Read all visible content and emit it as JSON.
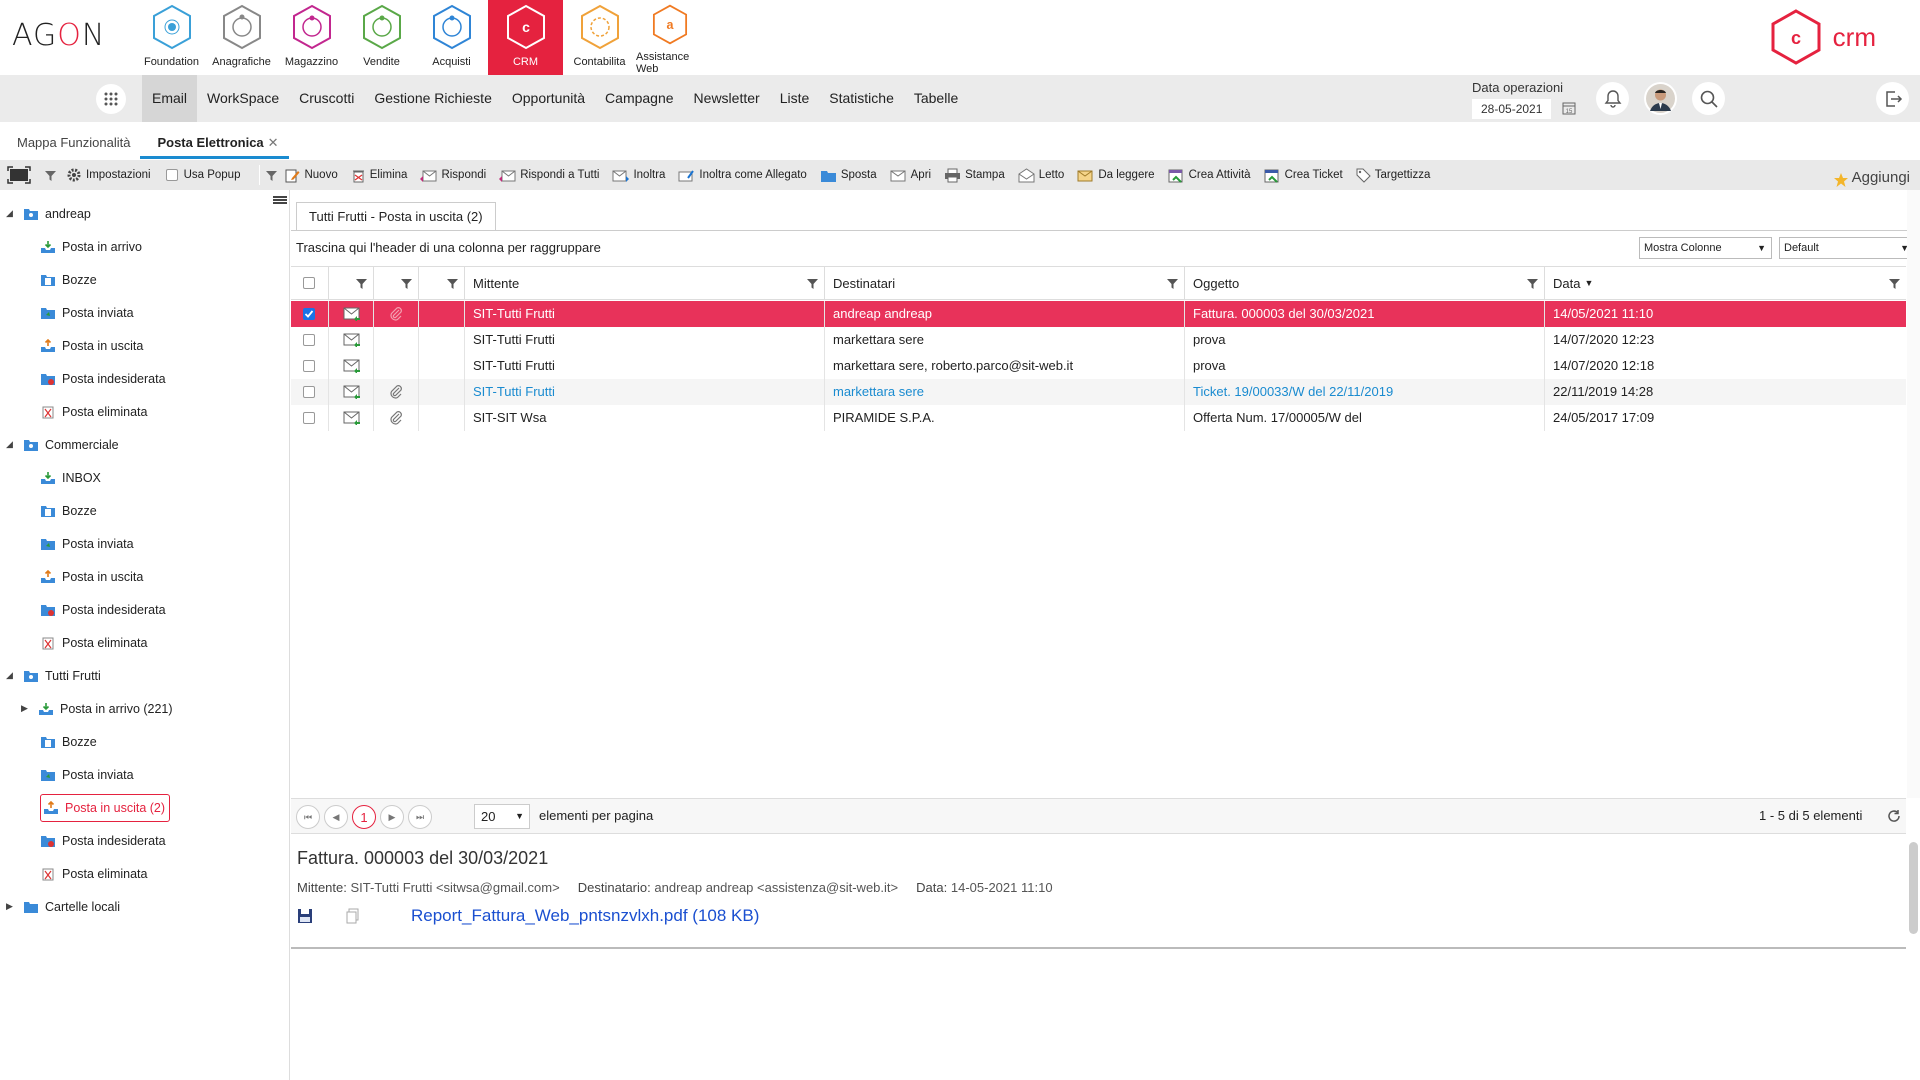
{
  "brand": "AGON",
  "modules": [
    {
      "label": "Foundation",
      "icon": "foundation-icon",
      "color": "#3aa0d8"
    },
    {
      "label": "Anagrafiche",
      "icon": "anagrafiche-icon",
      "color": "#888888"
    },
    {
      "label": "Magazzino",
      "icon": "magazzino-icon",
      "color": "#c2278f"
    },
    {
      "label": "Vendite",
      "icon": "vendite-icon",
      "color": "#5aa848"
    },
    {
      "label": "Acquisti",
      "icon": "acquisti-icon",
      "color": "#2f85d6"
    },
    {
      "label": "CRM",
      "icon": "crm-icon",
      "color": "#e5223f",
      "active": true
    },
    {
      "label": "Contabilita",
      "icon": "contabilita-icon",
      "color": "#f0a23a"
    },
    {
      "label": "Assistance Web",
      "icon": "assistance-icon",
      "color": "#f07a22"
    }
  ],
  "crm_logo": {
    "letter": "c",
    "text": "crm",
    "color": "#e5223f"
  },
  "menu": [
    "Email",
    "WorkSpace",
    "Cruscotti",
    "Gestione Richieste",
    "Opportunità",
    "Campagne",
    "Newsletter",
    "Liste",
    "Statistiche",
    "Tabelle"
  ],
  "data_operazioni": {
    "label": "Data operazioni",
    "value": "28-05-2021"
  },
  "tabs": [
    {
      "label": "Mappa Funzionalità"
    },
    {
      "label": "Posta Elettronica",
      "close": "✕"
    }
  ],
  "toolbar": {
    "settings": "Impostazioni",
    "popup": "Usa Popup",
    "actions": [
      "Nuovo",
      "Elimina",
      "Rispondi",
      "Rispondi a Tutti",
      "Inoltra",
      "Inoltra come Allegato",
      "Sposta",
      "Apri",
      "Stampa",
      "Letto",
      "Da leggere",
      "Crea Attività",
      "Crea Ticket",
      "Targettizza"
    ],
    "add": "Aggiungi"
  },
  "tree": [
    {
      "label": "andreap",
      "level": 0,
      "open": true,
      "icon": "account"
    },
    {
      "label": "Posta in arrivo",
      "level": 1,
      "icon": "inbox"
    },
    {
      "label": "Bozze",
      "level": 1,
      "icon": "drafts"
    },
    {
      "label": "Posta inviata",
      "level": 1,
      "icon": "sent"
    },
    {
      "label": "Posta in uscita",
      "level": 1,
      "icon": "outbox"
    },
    {
      "label": "Posta indesiderata",
      "level": 1,
      "icon": "junk"
    },
    {
      "label": "Posta eliminata",
      "level": 1,
      "icon": "trash"
    },
    {
      "label": "Commerciale",
      "level": 0,
      "open": true,
      "icon": "account"
    },
    {
      "label": "INBOX",
      "level": 1,
      "icon": "inbox"
    },
    {
      "label": "Bozze",
      "level": 1,
      "icon": "drafts"
    },
    {
      "label": "Posta inviata",
      "level": 1,
      "icon": "sent"
    },
    {
      "label": "Posta in uscita",
      "level": 1,
      "icon": "outbox"
    },
    {
      "label": "Posta indesiderata",
      "level": 1,
      "icon": "junk"
    },
    {
      "label": "Posta eliminata",
      "level": 1,
      "icon": "trash"
    },
    {
      "label": "Tutti Frutti",
      "level": 0,
      "open": true,
      "icon": "account"
    },
    {
      "label": "Posta in arrivo (221)",
      "level": 1,
      "icon": "inbox",
      "collapsed": true
    },
    {
      "label": "Bozze",
      "level": 1,
      "icon": "drafts"
    },
    {
      "label": "Posta inviata",
      "level": 1,
      "icon": "sent"
    },
    {
      "label": "Posta in uscita (2)",
      "level": 1,
      "icon": "outbox",
      "selected": true
    },
    {
      "label": "Posta indesiderata",
      "level": 1,
      "icon": "junk"
    },
    {
      "label": "Posta eliminata",
      "level": 1,
      "icon": "trash"
    },
    {
      "label": "Cartelle locali",
      "level": 0,
      "collapsed": true,
      "icon": "folder"
    }
  ],
  "grid": {
    "tab": "Tutti Frutti - Posta in uscita (2)",
    "group_hint": "Trascina qui l'header di una colonna per raggruppare",
    "columns_dd": "Mostra Colonne",
    "view_dd": "Default",
    "headers": {
      "sender": "Mittente",
      "recipients": "Destinatari",
      "subject": "Oggetto",
      "date": "Data"
    },
    "sort_indicator": "▼",
    "rows": [
      {
        "checked": true,
        "attach": true,
        "sender": "SIT-Tutti Frutti",
        "recipients": "andreap andreap",
        "subject": "Fattura. 000003 del 30/03/2021",
        "date": "14/05/2021 11:10",
        "selected": true
      },
      {
        "checked": false,
        "attach": false,
        "sender": "SIT-Tutti Frutti",
        "recipients": "markettara sere",
        "subject": "prova",
        "date": "14/07/2020 12:23"
      },
      {
        "checked": false,
        "attach": false,
        "sender": "SIT-Tutti Frutti",
        "recipients": "markettara sere, roberto.parco@sit-web.it",
        "subject": "prova",
        "date": "14/07/2020 12:18"
      },
      {
        "checked": false,
        "attach": true,
        "sender": "SIT-Tutti Frutti",
        "recipients": "markettara sere",
        "subject": "Ticket. 19/00033/W del 22/11/2019",
        "date": "22/11/2019 14:28",
        "link": true
      },
      {
        "checked": false,
        "attach": true,
        "sender": "SIT-SIT Wsa",
        "recipients": "PIRAMIDE S.P.A.",
        "subject": "Offerta Num. 17/00005/W del",
        "date": "24/05/2017 17:09"
      }
    ],
    "pager": {
      "page": "1",
      "size": "20",
      "size_label": "elementi per pagina",
      "summary": "1 - 5 di 5 elementi"
    }
  },
  "preview": {
    "title": "Fattura. 000003 del 30/03/2021",
    "sender_label": "Mittente:",
    "sender": "SIT-Tutti Frutti <sitwsa@gmail.com>",
    "recipient_label": "Destinatario:",
    "recipient": "andreap andreap <assistenza@sit-web.it>",
    "date_label": "Data:",
    "date": "14-05-2021 11:10",
    "attachment": "Report_Fattura_Web_pntsnzvlxh.pdf (108 KB)"
  }
}
